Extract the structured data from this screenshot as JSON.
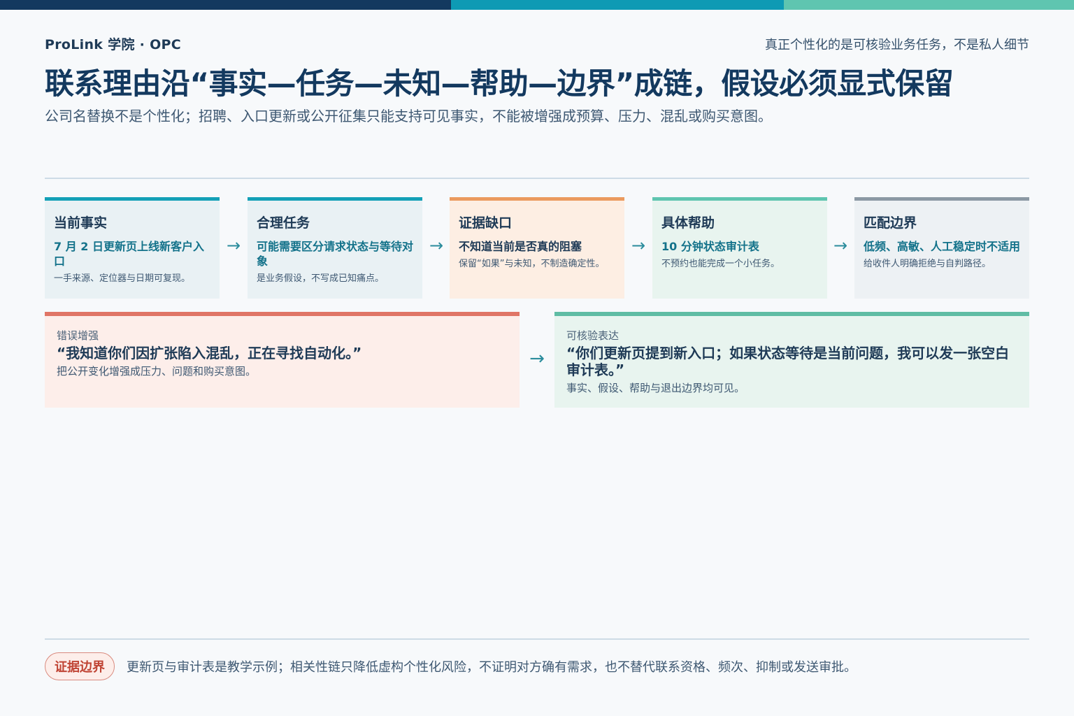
{
  "header": {
    "brand": "ProLink 学院 · OPC",
    "tagline": "真正个性化的是可核验业务任务，不是私人细节",
    "title": "联系理由沿“事实—任务—未知—帮助—边界”成链，假设必须显式保留",
    "subtitle": "公司名替换不是个性化；招聘、入口更新或公开征集只能支持可见事实，不能被增强成预算、压力、混乱或购买意图。"
  },
  "steps": [
    {
      "heading": "当前事实",
      "bold": "7 月 2 日更新页上线新客户入口",
      "note": "一手来源、定位器与日期可复现。"
    },
    {
      "heading": "合理任务",
      "bold": "可能需要区分请求状态与等待对象",
      "note": "是业务假设，不写成已知痛点。"
    },
    {
      "heading": "证据缺口",
      "bold": "不知道当前是否真的阻塞",
      "note": "保留“如果”与未知，不制造确定性。"
    },
    {
      "heading": "具体帮助",
      "bold": "10 分钟状态审计表",
      "note": "不预约也能完成一个小任务。"
    },
    {
      "heading": "匹配边界",
      "bold": "低频、高敏、人工稳定时不适用",
      "note": "给收件人明确拒绝与自判路径。"
    }
  ],
  "arrow": "→",
  "comparison": {
    "wrong": {
      "label": "错误增强",
      "quote": "“我知道你们因扩张陷入混乱，正在寻找自动化。”",
      "desc": "把公开变化增强成压力、问题和购买意图。"
    },
    "right": {
      "label": "可核验表达",
      "quote": "“你们更新页提到新入口；如果状态等待是当前问题，我可以发一张空白审计表。”",
      "desc": "事实、假设、帮助与退出边界均可见。"
    }
  },
  "footer": {
    "badge": "证据边界",
    "text": "更新页与审计表是教学示例；相关性链只降低虚构个性化风险，不证明对方确有需求，也不替代联系资格、频次、抑制或发送审批。"
  },
  "colors": {
    "navy": "#13395f",
    "teal": "#0e9ab4",
    "mint": "#5fc5b0",
    "orange": "#eb9a5e",
    "gray": "#8c99a4",
    "red": "#e07566"
  }
}
